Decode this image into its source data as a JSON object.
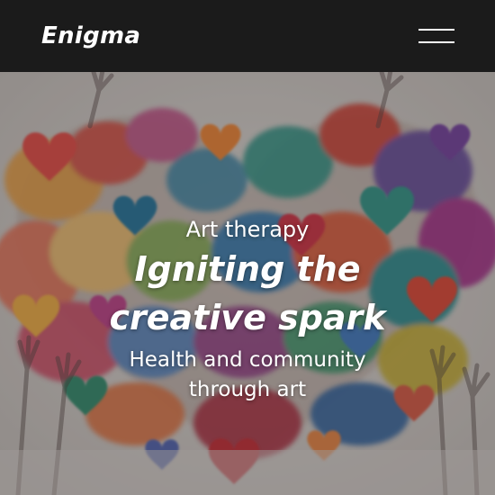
{
  "header": {
    "logo_text": "Enigma",
    "menu_icon": "hamburger-menu-icon",
    "background_color": "#1b1b1b"
  },
  "hero": {
    "image_subject": "watercolor hearts and raised hands",
    "eyebrow": "Art therapy",
    "headline": "Igniting the creative spark",
    "subline": "Health and community through art",
    "text_color": "#ffffff"
  }
}
